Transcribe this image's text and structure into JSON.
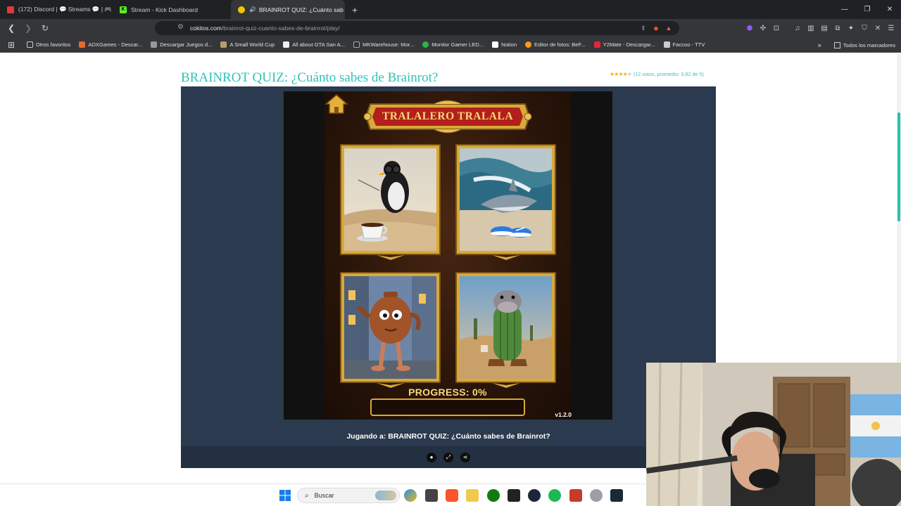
{
  "browser": {
    "tabs": [
      {
        "label": "(172) Discord | 💬 Streams 💬 | 🎮",
        "active": false,
        "favicon": "discord-icon"
      },
      {
        "label": "Stream - Kick Dashboard",
        "active": false,
        "favicon": "kick-icon"
      },
      {
        "label": "BRAINROT QUIZ: ¿Cuánto sab",
        "active": true,
        "favicon": "speaker-icon"
      }
    ],
    "url_domain": "cokitos.com",
    "url_path": "/brainrot-quiz-cuanto-sabes-de-brainrot/play/",
    "bookmarks": [
      "Otros favoritos",
      "ADXGames - Descar...",
      "Descargar Juegos d...",
      "A Small World Cup",
      "All about GTA San A...",
      "MKWarehouse: Mor...",
      "Monitor Gamer LED...",
      "Notion",
      "Editor de fotos: BeF...",
      "Y2Mate - Descargar...",
      "Faccoo - TTV"
    ],
    "bookmarks_right": "Todos los marcadores"
  },
  "page": {
    "title": "BRAINROT QUIZ: ¿Cuánto sabes de Brainrot?",
    "rating_text": "(12 votos, promedio: 3,92 de 5)",
    "rating_value": 3.92,
    "rating_max": 5,
    "playing_text": "Jugando a: BRAINROT QUIZ: ¿Cuánto sabes de Brainrot?"
  },
  "game": {
    "banner": "TRALALERO TRALALA",
    "progress_label": "PROGRESS: 0%",
    "progress_value": 0,
    "version": "v1.2.0",
    "options": [
      {
        "name": "penguin-coffee-option"
      },
      {
        "name": "shark-sneakers-option"
      },
      {
        "name": "teapot-man-option"
      },
      {
        "name": "hippo-cactus-option"
      }
    ]
  },
  "taskbar": {
    "search_placeholder": "Buscar"
  },
  "colors": {
    "title_teal": "#2ec2b8",
    "game_bg": "#2b3a4e",
    "gold": "#d8a93a",
    "banner_red": "#b31f1a"
  }
}
